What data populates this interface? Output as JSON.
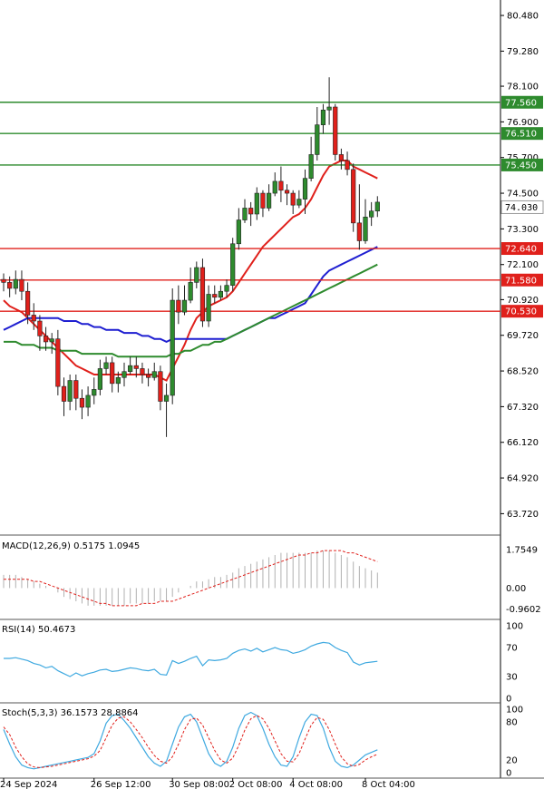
{
  "chart_data": {
    "type": "candlestick",
    "price_axis": {
      "ticks": [
        "80.480",
        "79.280",
        "78.100",
        "76.900",
        "75.700",
        "74.500",
        "73.300",
        "72.100",
        "70.920",
        "69.720",
        "68.520",
        "67.320",
        "66.120",
        "64.920",
        "63.720"
      ],
      "ylim": [
        63.0,
        81.0
      ],
      "current_price": "74.030"
    },
    "time_axis": {
      "labels": [
        "24 Sep 2024",
        "26 Sep 12:00",
        "30 Sep 08:00",
        "2 Oct 08:00",
        "4 Oct 08:00",
        "8 Oct 04:00"
      ]
    },
    "horizontal_levels": [
      {
        "label": "77.560",
        "value": 77.56,
        "color": "#2e8b2e"
      },
      {
        "label": "76.510",
        "value": 76.51,
        "color": "#2e8b2e"
      },
      {
        "label": "75.450",
        "value": 75.45,
        "color": "#2e8b2e"
      },
      {
        "label": "72.640",
        "value": 72.64,
        "color": "#e0201b"
      },
      {
        "label": "71.580",
        "value": 71.58,
        "color": "#e0201b"
      },
      {
        "label": "70.530",
        "value": 70.53,
        "color": "#e0201b"
      }
    ],
    "candles": [
      [
        71.6,
        71.5,
        71.8,
        71.2
      ],
      [
        71.5,
        71.3,
        71.7,
        71.0
      ],
      [
        71.3,
        71.6,
        71.9,
        71.1
      ],
      [
        71.6,
        71.2,
        71.9,
        70.9
      ],
      [
        71.2,
        70.4,
        71.5,
        70.1
      ],
      [
        70.4,
        70.2,
        70.8,
        69.9
      ],
      [
        70.2,
        69.7,
        70.4,
        69.2
      ],
      [
        69.7,
        69.5,
        70.0,
        69.2
      ],
      [
        69.5,
        69.6,
        69.8,
        69.1
      ],
      [
        69.6,
        68.0,
        69.9,
        67.7
      ],
      [
        68.0,
        67.5,
        68.3,
        67.0
      ],
      [
        67.5,
        68.2,
        68.4,
        67.2
      ],
      [
        68.2,
        67.6,
        68.4,
        67.2
      ],
      [
        67.6,
        67.3,
        67.9,
        66.9
      ],
      [
        67.3,
        67.7,
        68.0,
        67.0
      ],
      [
        67.7,
        67.9,
        68.3,
        67.4
      ],
      [
        67.9,
        68.6,
        68.9,
        67.7
      ],
      [
        68.6,
        68.8,
        69.0,
        68.4
      ],
      [
        68.8,
        68.1,
        69.0,
        67.8
      ],
      [
        68.1,
        68.3,
        68.5,
        67.8
      ],
      [
        68.3,
        68.5,
        68.8,
        68.0
      ],
      [
        68.5,
        68.7,
        69.0,
        68.4
      ],
      [
        68.7,
        68.6,
        69.0,
        68.3
      ],
      [
        68.6,
        68.4,
        68.8,
        68.1
      ],
      [
        68.4,
        68.3,
        68.6,
        68.0
      ],
      [
        68.3,
        68.5,
        68.8,
        68.2
      ],
      [
        68.5,
        67.5,
        68.7,
        67.2
      ],
      [
        67.5,
        67.7,
        68.1,
        66.3
      ],
      [
        67.7,
        70.9,
        71.3,
        67.4
      ],
      [
        70.9,
        70.5,
        71.4,
        70.1
      ],
      [
        70.5,
        70.9,
        71.4,
        70.4
      ],
      [
        70.9,
        71.5,
        72.0,
        70.8
      ],
      [
        71.5,
        72.0,
        72.2,
        71.3
      ],
      [
        72.0,
        70.2,
        72.3,
        70.0
      ],
      [
        70.2,
        71.1,
        71.4,
        70.0
      ],
      [
        71.1,
        71.0,
        71.4,
        70.8
      ],
      [
        71.0,
        71.2,
        71.4,
        70.9
      ],
      [
        71.2,
        71.4,
        71.6,
        71.0
      ],
      [
        71.4,
        72.8,
        73.0,
        71.2
      ],
      [
        72.8,
        73.6,
        74.0,
        72.6
      ],
      [
        73.6,
        74.0,
        74.3,
        73.5
      ],
      [
        74.0,
        73.8,
        74.2,
        73.4
      ],
      [
        73.8,
        74.5,
        74.7,
        73.6
      ],
      [
        74.5,
        74.0,
        74.6,
        73.7
      ],
      [
        74.0,
        74.5,
        74.8,
        73.9
      ],
      [
        74.5,
        74.9,
        75.2,
        74.4
      ],
      [
        74.9,
        74.6,
        75.4,
        74.2
      ],
      [
        74.6,
        74.5,
        74.8,
        74.1
      ],
      [
        74.5,
        74.1,
        74.6,
        73.8
      ],
      [
        74.1,
        74.3,
        74.6,
        74.0
      ],
      [
        74.3,
        75.0,
        75.3,
        73.8
      ],
      [
        75.0,
        75.8,
        76.4,
        74.9
      ],
      [
        75.8,
        76.8,
        77.4,
        75.6
      ],
      [
        76.8,
        77.3,
        77.5,
        76.5
      ],
      [
        77.3,
        77.4,
        78.4,
        76.8
      ],
      [
        77.4,
        75.8,
        77.5,
        75.6
      ],
      [
        75.8,
        75.6,
        76.0,
        75.3
      ],
      [
        75.6,
        75.3,
        75.9,
        75.1
      ],
      [
        75.3,
        73.5,
        75.5,
        73.2
      ],
      [
        73.5,
        72.9,
        74.8,
        72.6
      ],
      [
        72.9,
        73.7,
        74.3,
        72.8
      ],
      [
        73.7,
        73.9,
        74.2,
        73.4
      ],
      [
        73.9,
        74.2,
        74.4,
        73.7
      ]
    ],
    "overlays": [
      {
        "color": "#e0201b",
        "values": [
          70.9,
          70.7,
          70.6,
          70.5,
          70.3,
          70.1,
          69.9,
          69.7,
          69.5,
          69.3,
          69.1,
          68.9,
          68.7,
          68.6,
          68.5,
          68.4,
          68.4,
          68.4,
          68.4,
          68.4,
          68.4,
          68.4,
          68.4,
          68.4,
          68.4,
          68.4,
          68.3,
          68.2,
          68.6,
          69.0,
          69.4,
          69.9,
          70.3,
          70.5,
          70.7,
          70.8,
          70.9,
          71.0,
          71.2,
          71.5,
          71.8,
          72.1,
          72.4,
          72.7,
          72.9,
          73.1,
          73.3,
          73.5,
          73.7,
          73.8,
          74.0,
          74.3,
          74.7,
          75.1,
          75.4,
          75.5,
          75.6,
          75.6,
          75.4,
          75.3,
          75.2,
          75.1,
          75.0
        ]
      },
      {
        "color": "#1f1fd1",
        "values": [
          69.9,
          70.0,
          70.1,
          70.2,
          70.3,
          70.3,
          70.3,
          70.3,
          70.3,
          70.3,
          70.2,
          70.2,
          70.2,
          70.1,
          70.1,
          70.0,
          70.0,
          69.9,
          69.9,
          69.9,
          69.8,
          69.8,
          69.8,
          69.7,
          69.7,
          69.6,
          69.6,
          69.5,
          69.6,
          69.6,
          69.6,
          69.6,
          69.6,
          69.6,
          69.6,
          69.6,
          69.6,
          69.6,
          69.7,
          69.8,
          69.9,
          70.0,
          70.1,
          70.2,
          70.3,
          70.3,
          70.4,
          70.5,
          70.6,
          70.7,
          70.8,
          71.1,
          71.4,
          71.7,
          71.9,
          72.0,
          72.1,
          72.2,
          72.3,
          72.4,
          72.5,
          72.6,
          72.7
        ]
      },
      {
        "color": "#2e8b2e",
        "values": [
          69.5,
          69.5,
          69.5,
          69.4,
          69.4,
          69.4,
          69.3,
          69.3,
          69.3,
          69.2,
          69.2,
          69.2,
          69.2,
          69.1,
          69.1,
          69.1,
          69.1,
          69.1,
          69.1,
          69.0,
          69.0,
          69.0,
          69.0,
          69.0,
          69.0,
          69.0,
          69.0,
          69.0,
          69.1,
          69.1,
          69.2,
          69.2,
          69.3,
          69.4,
          69.4,
          69.5,
          69.5,
          69.6,
          69.7,
          69.8,
          69.9,
          70.0,
          70.1,
          70.2,
          70.3,
          70.4,
          70.5,
          70.6,
          70.7,
          70.8,
          70.9,
          71.0,
          71.1,
          71.2,
          71.3,
          71.4,
          71.5,
          71.6,
          71.7,
          71.8,
          71.9,
          72.0,
          72.1
        ]
      }
    ],
    "macd": {
      "label": "MACD(12,26,9) 0.5175 1.0945",
      "ticks": [
        "1.7549",
        "0.00",
        "-0.9602"
      ],
      "ylim": [
        -1.3,
        2.2
      ],
      "hist": [
        0.6,
        0.6,
        0.6,
        0.5,
        0.4,
        0.3,
        0.2,
        0.1,
        0.0,
        -0.2,
        -0.4,
        -0.5,
        -0.6,
        -0.7,
        -0.8,
        -0.8,
        -0.8,
        -0.8,
        -0.8,
        -0.8,
        -0.8,
        -0.7,
        -0.7,
        -0.7,
        -0.7,
        -0.6,
        -0.6,
        -0.6,
        -0.4,
        -0.2,
        0.0,
        0.1,
        0.3,
        0.3,
        0.4,
        0.5,
        0.5,
        0.6,
        0.7,
        0.9,
        1.0,
        1.1,
        1.2,
        1.3,
        1.4,
        1.5,
        1.6,
        1.6,
        1.6,
        1.6,
        1.6,
        1.6,
        1.7,
        1.7,
        1.7,
        1.6,
        1.5,
        1.4,
        1.2,
        1.0,
        0.9,
        0.8,
        0.7
      ],
      "signal": [
        0.4,
        0.4,
        0.4,
        0.4,
        0.4,
        0.3,
        0.3,
        0.2,
        0.1,
        0.0,
        -0.1,
        -0.2,
        -0.3,
        -0.4,
        -0.5,
        -0.6,
        -0.7,
        -0.7,
        -0.8,
        -0.8,
        -0.8,
        -0.8,
        -0.8,
        -0.7,
        -0.7,
        -0.7,
        -0.6,
        -0.6,
        -0.6,
        -0.5,
        -0.4,
        -0.3,
        -0.2,
        -0.1,
        0.0,
        0.1,
        0.2,
        0.3,
        0.4,
        0.5,
        0.6,
        0.7,
        0.8,
        0.9,
        1.0,
        1.1,
        1.2,
        1.3,
        1.4,
        1.5,
        1.5,
        1.6,
        1.6,
        1.7,
        1.7,
        1.7,
        1.7,
        1.6,
        1.6,
        1.5,
        1.4,
        1.3,
        1.2
      ]
    },
    "rsi": {
      "label": "RSI(14) 50.4673",
      "ticks": [
        "100",
        "70",
        "30",
        "0"
      ],
      "ylim": [
        0,
        100
      ],
      "values": [
        55,
        55,
        56,
        54,
        52,
        48,
        46,
        42,
        44,
        38,
        34,
        30,
        35,
        31,
        34,
        36,
        39,
        40,
        37,
        38,
        40,
        42,
        41,
        39,
        38,
        40,
        33,
        32,
        52,
        48,
        51,
        55,
        58,
        45,
        53,
        52,
        53,
        55,
        62,
        66,
        68,
        65,
        69,
        64,
        67,
        70,
        67,
        66,
        62,
        64,
        67,
        72,
        75,
        77,
        76,
        70,
        66,
        63,
        50,
        46,
        49,
        50,
        51
      ]
    },
    "stoch": {
      "label": "Stoch(5,3,3) 36.1573 28.8864",
      "ticks": [
        "100",
        "80",
        "20",
        "0"
      ],
      "ylim": [
        0,
        100
      ],
      "k": [
        68,
        45,
        25,
        12,
        8,
        6,
        8,
        10,
        12,
        14,
        16,
        18,
        20,
        22,
        24,
        30,
        50,
        78,
        90,
        92,
        82,
        70,
        55,
        40,
        25,
        15,
        10,
        18,
        45,
        72,
        88,
        92,
        80,
        55,
        30,
        15,
        10,
        18,
        40,
        70,
        90,
        95,
        90,
        70,
        45,
        25,
        12,
        10,
        25,
        55,
        80,
        92,
        90,
        70,
        40,
        18,
        10,
        8,
        12,
        20,
        28,
        32,
        36
      ],
      "d": [
        72,
        60,
        40,
        25,
        14,
        9,
        8,
        9,
        10,
        12,
        14,
        16,
        18,
        20,
        22,
        26,
        35,
        55,
        75,
        86,
        88,
        80,
        68,
        55,
        40,
        27,
        18,
        15,
        25,
        45,
        68,
        84,
        86,
        75,
        55,
        35,
        20,
        15,
        23,
        43,
        67,
        85,
        90,
        85,
        70,
        50,
        30,
        18,
        17,
        30,
        53,
        75,
        87,
        84,
        68,
        45,
        25,
        14,
        10,
        13,
        20,
        25,
        29
      ]
    }
  }
}
